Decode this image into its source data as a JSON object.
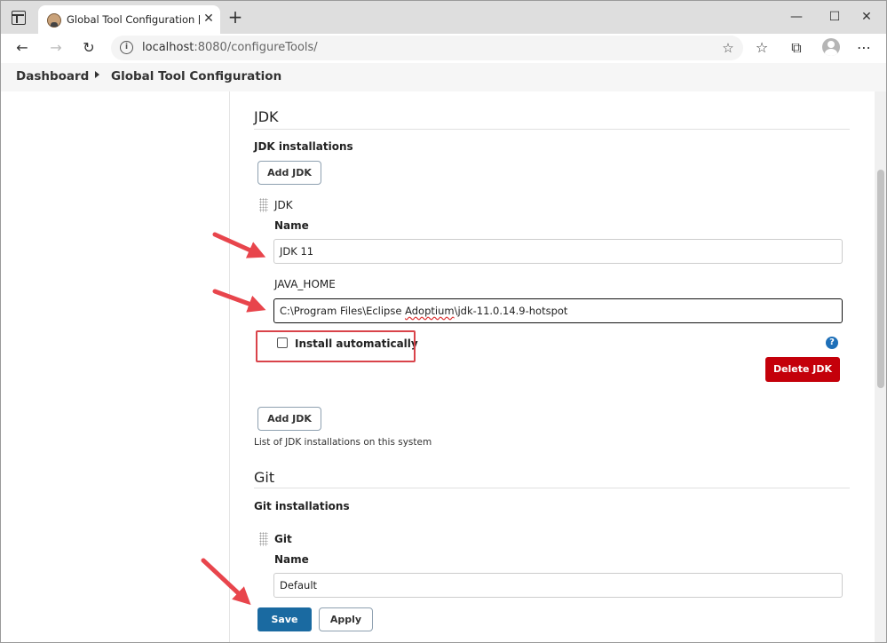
{
  "browser": {
    "tab_title": "Global Tool Configuration [Jenkins]",
    "tab_close": "✕",
    "new_tab": "+",
    "window_controls": {
      "minimize": "—",
      "maximize": "☐",
      "close": "✕"
    },
    "nav": {
      "back": "←",
      "forward": "→",
      "refresh": "↻"
    },
    "url_host": "localhost",
    "url_rest": ":8080/configureTools/",
    "toolbar_icons": [
      "favorites-icon",
      "collections-icon",
      "profile-icon",
      "more-icon"
    ],
    "more": "⋯"
  },
  "breadcrumb": {
    "items": [
      "Dashboard",
      "Global Tool Configuration"
    ]
  },
  "jdk": {
    "section_title": "JDK",
    "installations_label": "JDK installations",
    "add_button": "Add JDK",
    "item_header": "JDK",
    "name_label": "Name",
    "name_value": "JDK 11",
    "java_home_label": "JAVA_HOME",
    "java_home_prefix": "C:\\Program Files\\Eclipse ",
    "java_home_squiggle": "Adoptium",
    "java_home_suffix": "\\jdk-11.0.14.9-hotspot",
    "install_auto_label": "Install automatically",
    "install_auto_checked": false,
    "help": "?",
    "delete_button": "Delete JDK",
    "add_button_bottom": "Add JDK",
    "list_hint": "List of JDK installations on this system"
  },
  "git": {
    "section_title": "Git",
    "installations_label": "Git installations",
    "item_header": "Git",
    "name_label": "Name",
    "name_value": "Default"
  },
  "actions": {
    "save": "Save",
    "apply": "Apply"
  },
  "colors": {
    "primary": "#1a6aa1",
    "danger": "#c4000a",
    "annotation": "#e8454c"
  }
}
